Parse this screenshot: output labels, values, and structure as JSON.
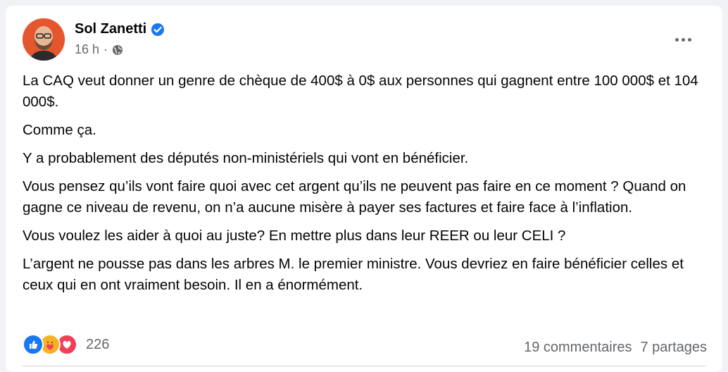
{
  "post": {
    "author": "Sol Zanetti",
    "time": "16 h",
    "separator": "·",
    "paragraphs": [
      "La CAQ veut donner un genre de chèque de 400$ à 0$ aux personnes qui gagnent entre 100 000$ et 104 000$.",
      "Comme ça.",
      "Y a probablement des députés non-ministériels qui vont en bénéficier.",
      "Vous pensez qu’ils vont faire quoi avec cet argent qu’ils ne peuvent pas faire en ce moment ? Quand on gagne ce niveau de revenu, on n’a aucune misère à payer ses factures et faire face à l’inflation.",
      "Vous voulez les aider à quoi au juste? En mettre plus dans leur REER ou leur CELI ?",
      "L’argent ne pousse pas dans les arbres M. le premier ministre. Vous devriez en faire bénéficier celles et ceux qui en ont vraiment besoin. Il en a énormément."
    ]
  },
  "footer": {
    "reaction_count": "226",
    "comments": "19 commentaires",
    "shares": "7 partages",
    "reaction_icons": [
      "like-icon",
      "care-icon",
      "love-icon"
    ]
  },
  "colors": {
    "verified": "#1877f2",
    "like": "#1877f2",
    "love": "#f33e58",
    "care": "#f7b125"
  }
}
